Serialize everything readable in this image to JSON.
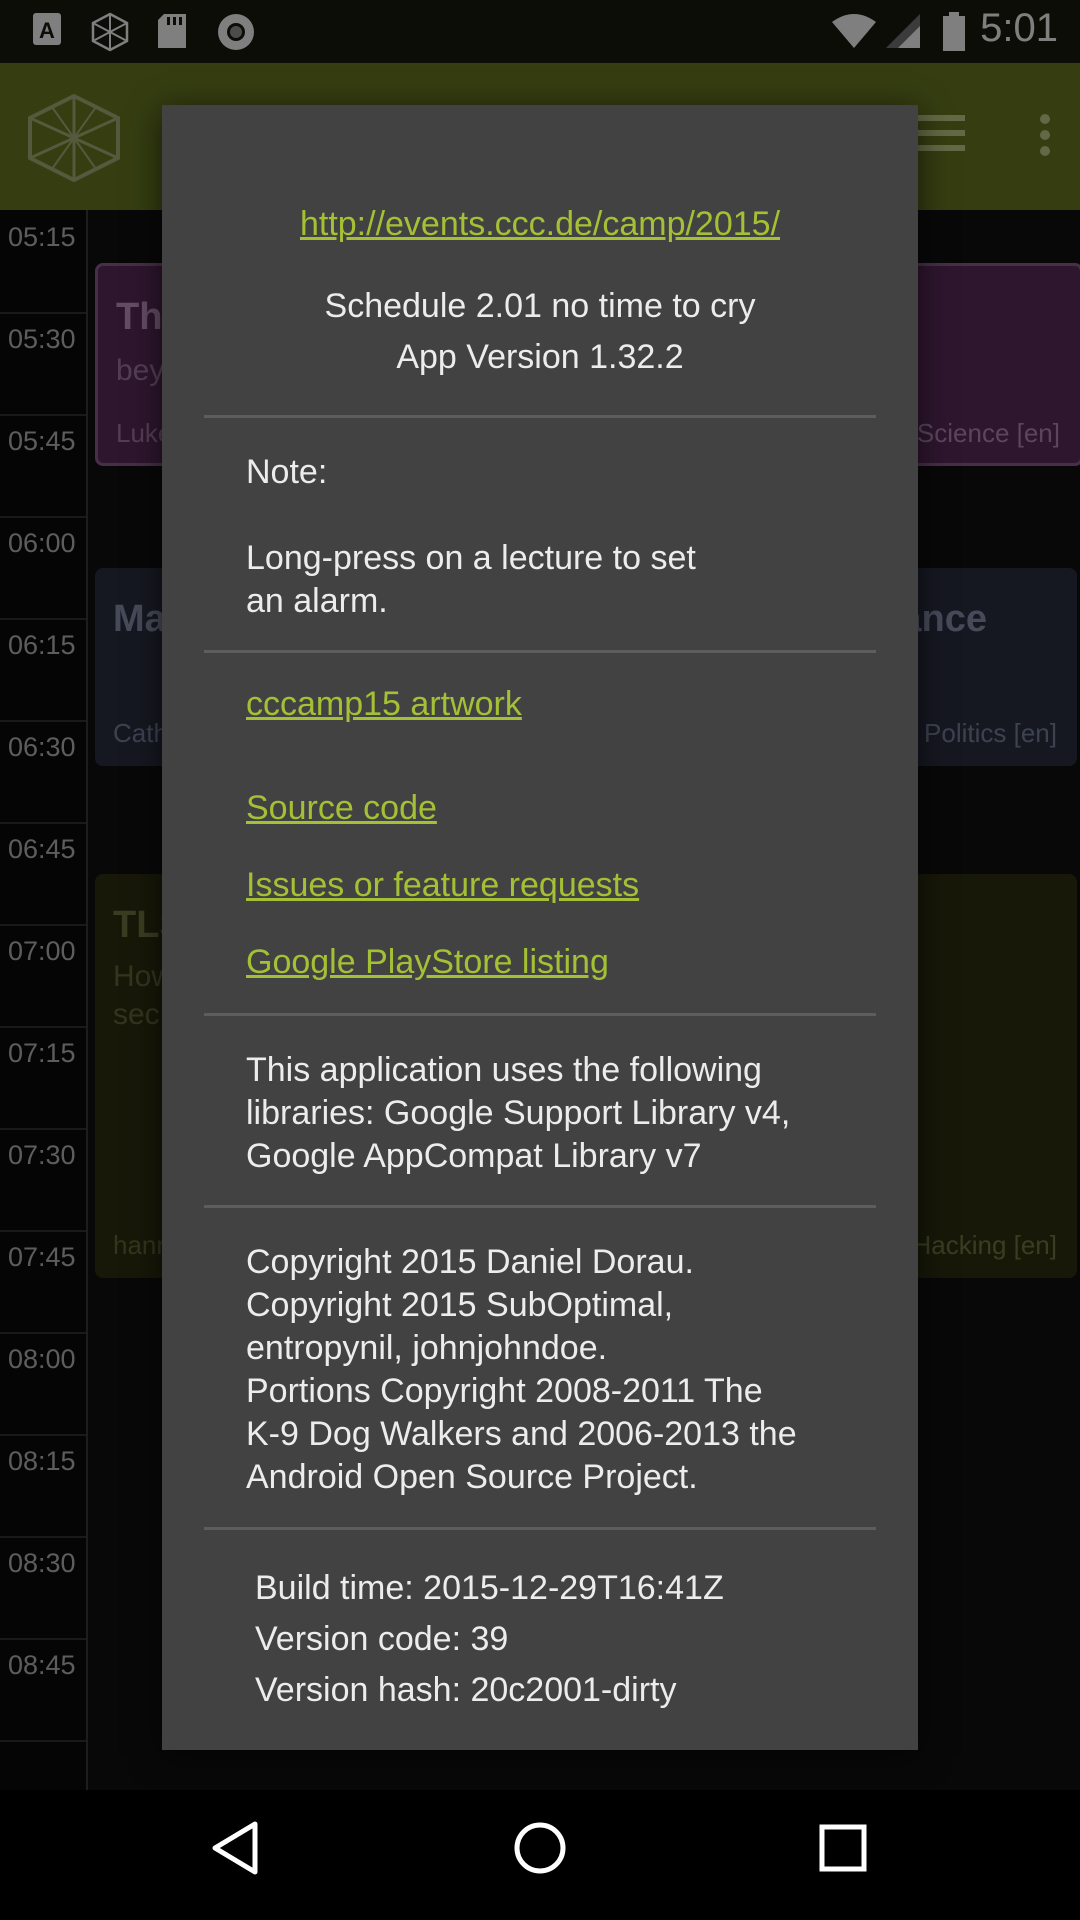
{
  "status_bar": {
    "time": "5:01"
  },
  "timeline": {
    "times": [
      "05:15",
      "05:30",
      "05:45",
      "06:00",
      "06:15",
      "06:30",
      "06:45",
      "07:00",
      "07:15",
      "07:30",
      "07:45",
      "08:00",
      "08:15",
      "08:30",
      "08:45"
    ]
  },
  "events": [
    {
      "title": "The",
      "subtitle": "bey",
      "speaker": "Luke",
      "track": "Science [en]"
    },
    {
      "title": "Ma",
      "title_right": "ance",
      "speaker": "Cath",
      "track": "Politics [en]"
    },
    {
      "title": "TLS",
      "subtitle": "How",
      "subtitle2": "sec",
      "speaker": "hann",
      "track": "Hacking [en]"
    }
  ],
  "dialog": {
    "url": "http://events.ccc.de/camp/2015/",
    "schedule_version": "Schedule 2.01 no time to cry",
    "app_version": "App Version 1.32.2",
    "note_label": "Note:",
    "note_text_1": "Long-press on a lecture to set",
    "note_text_2": "an alarm.",
    "links": {
      "artwork": "cccamp15 artwork",
      "source_code": "Source code",
      "issues": "Issues or feature requests",
      "playstore": "Google PlayStore listing"
    },
    "libraries": [
      "This application uses the following",
      "libraries: Google Support Library v4,",
      "Google AppCompat Library v7"
    ],
    "copyright": [
      "Copyright 2015 Daniel Dorau.",
      "Copyright 2015 SubOptimal,",
      "entropynil, johnjohndoe.",
      "Portions Copyright 2008-2011 The",
      "K-9 Dog Walkers and 2006-2013 the",
      "Android Open Source Project."
    ],
    "build": [
      "Build time: 2015-12-29T16:41Z",
      "Version code: 39",
      "Version hash: 20c2001-dirty"
    ]
  },
  "colors": {
    "accent_link": "#a4c035",
    "appbar": "#6b7a22",
    "dialog_bg": "#424242"
  }
}
